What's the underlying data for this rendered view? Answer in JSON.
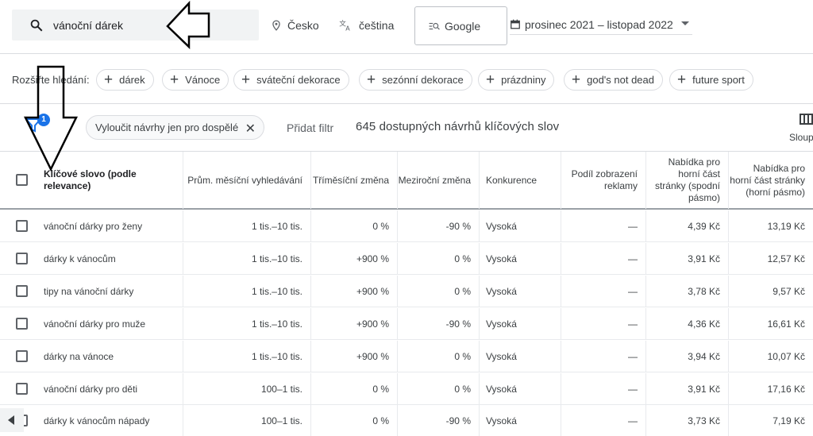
{
  "search": {
    "query": "vánoční dárek"
  },
  "location": {
    "label": "Česko"
  },
  "language": {
    "label": "čeština"
  },
  "network": {
    "label": "Google"
  },
  "date_range": {
    "label": "prosinec 2021 – listopad 2022"
  },
  "broaden": {
    "label": "Rozšiřte hledání:",
    "chips": [
      "dárek",
      "Vánoce",
      "sváteční dekorace",
      "sezónní dekorace",
      "prázdniny",
      "god's not dead",
      "future sport"
    ]
  },
  "filters": {
    "badge_count": "1",
    "active_filter": "Vyloučit návrhy jen pro dospělé",
    "add_filter": "Přidat filtr",
    "result_count": "645 dostupných návrhů klíčových slov",
    "columns_label": "Sloup"
  },
  "table": {
    "headers": {
      "keyword": "Klíčové slovo (podle relevance)",
      "avg_searches": "Prům. měsíční vyhledávání",
      "three_month": "Tříměsíční změna",
      "yoy": "Meziroční změna",
      "competition": "Konkurence",
      "impr_share": "Podíl zobrazení reklamy",
      "bid_low": "Nabídka pro horní část stránky (spodní pásmo)",
      "bid_high": "Nabídka pro horní část stránky (horní pásmo)"
    },
    "rows": [
      {
        "keyword": "vánoční dárky pro ženy",
        "avg": "1 tis.–10 tis.",
        "three": "0 %",
        "yoy": "-90 %",
        "comp": "Vysoká",
        "share": "—",
        "low": "4,39 Kč",
        "high": "13,19 Kč"
      },
      {
        "keyword": "dárky k vánocům",
        "avg": "1 tis.–10 tis.",
        "three": "+900 %",
        "yoy": "0 %",
        "comp": "Vysoká",
        "share": "—",
        "low": "3,91 Kč",
        "high": "12,57 Kč"
      },
      {
        "keyword": "tipy na vánoční dárky",
        "avg": "1 tis.–10 tis.",
        "three": "+900 %",
        "yoy": "0 %",
        "comp": "Vysoká",
        "share": "—",
        "low": "3,78 Kč",
        "high": "9,57 Kč"
      },
      {
        "keyword": "vánoční dárky pro muže",
        "avg": "1 tis.–10 tis.",
        "three": "+900 %",
        "yoy": "-90 %",
        "comp": "Vysoká",
        "share": "—",
        "low": "4,36 Kč",
        "high": "16,61 Kč"
      },
      {
        "keyword": "dárky na vánoce",
        "avg": "1 tis.–10 tis.",
        "three": "+900 %",
        "yoy": "0 %",
        "comp": "Vysoká",
        "share": "—",
        "low": "3,94 Kč",
        "high": "10,07 Kč"
      },
      {
        "keyword": "vánoční dárky pro děti",
        "avg": "100–1 tis.",
        "three": "0 %",
        "yoy": "0 %",
        "comp": "Vysoká",
        "share": "—",
        "low": "3,91 Kč",
        "high": "17,16 Kč"
      },
      {
        "keyword": "dárky k vánocům nápady",
        "avg": "100–1 tis.",
        "three": "0 %",
        "yoy": "-90 %",
        "comp": "Vysoká",
        "share": "—",
        "low": "3,73 Kč",
        "high": "7,19 Kč"
      }
    ]
  }
}
